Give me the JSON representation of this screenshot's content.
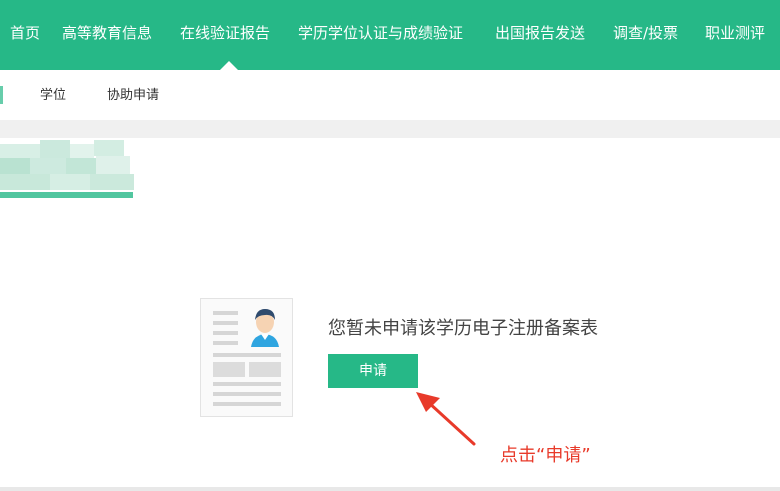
{
  "topnav": {
    "items": [
      {
        "label": "首页"
      },
      {
        "label": "高等教育信息"
      },
      {
        "label": "在线验证报告"
      },
      {
        "label": "学历学位认证与成绩验证"
      },
      {
        "label": "出国报告发送"
      },
      {
        "label": "调查/投票"
      },
      {
        "label": "职业测评"
      }
    ],
    "active_index": 2
  },
  "subnav": {
    "items": [
      {
        "label": "学位"
      },
      {
        "label": "协助申请"
      }
    ]
  },
  "empty_state": {
    "message": "您暂未申请该学历电子注册备案表",
    "apply_button": "申请"
  },
  "annotation": {
    "text": "点击“申请”"
  },
  "colors": {
    "brand_green": "#26b887",
    "annotation_red": "#e83a2a"
  }
}
